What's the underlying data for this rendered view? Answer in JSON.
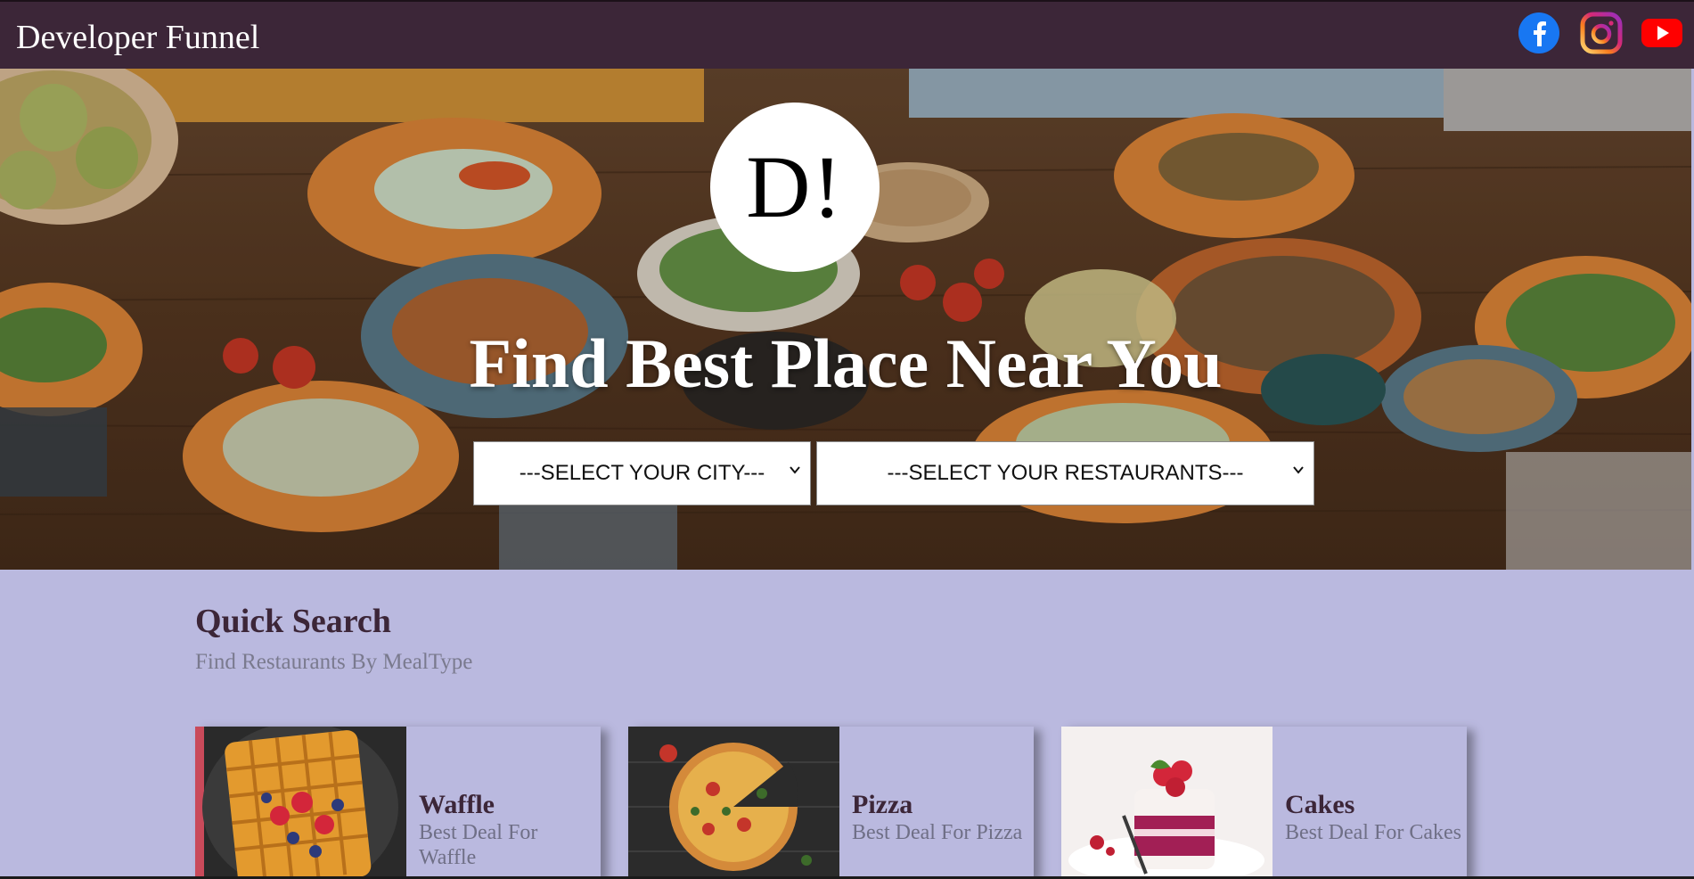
{
  "header": {
    "brand": "Developer Funnel",
    "social": [
      {
        "name": "facebook",
        "icon": "facebook-icon",
        "color": "#1877f2"
      },
      {
        "name": "instagram",
        "icon": "instagram-icon",
        "color": "#c13584"
      },
      {
        "name": "youtube",
        "icon": "youtube-icon",
        "color": "#ff0000"
      }
    ]
  },
  "hero": {
    "logo_text": "D!",
    "title": "Find Best Place Near You",
    "city_select": "---SELECT YOUR CITY---",
    "restaurant_select": "---SELECT YOUR RESTAURANTS---"
  },
  "quick_search": {
    "title": "Quick Search",
    "subtitle": "Find Restaurants By MealType",
    "cards": [
      {
        "title": "Waffle",
        "desc": "Best Deal For Waffle"
      },
      {
        "title": "Pizza",
        "desc": "Best Deal For Pizza"
      },
      {
        "title": "Cakes",
        "desc": "Best Deal For Cakes"
      }
    ]
  },
  "colors": {
    "header_bg": "#3c2638",
    "page_bg": "#bab9df",
    "accent_text": "#3c2638"
  }
}
